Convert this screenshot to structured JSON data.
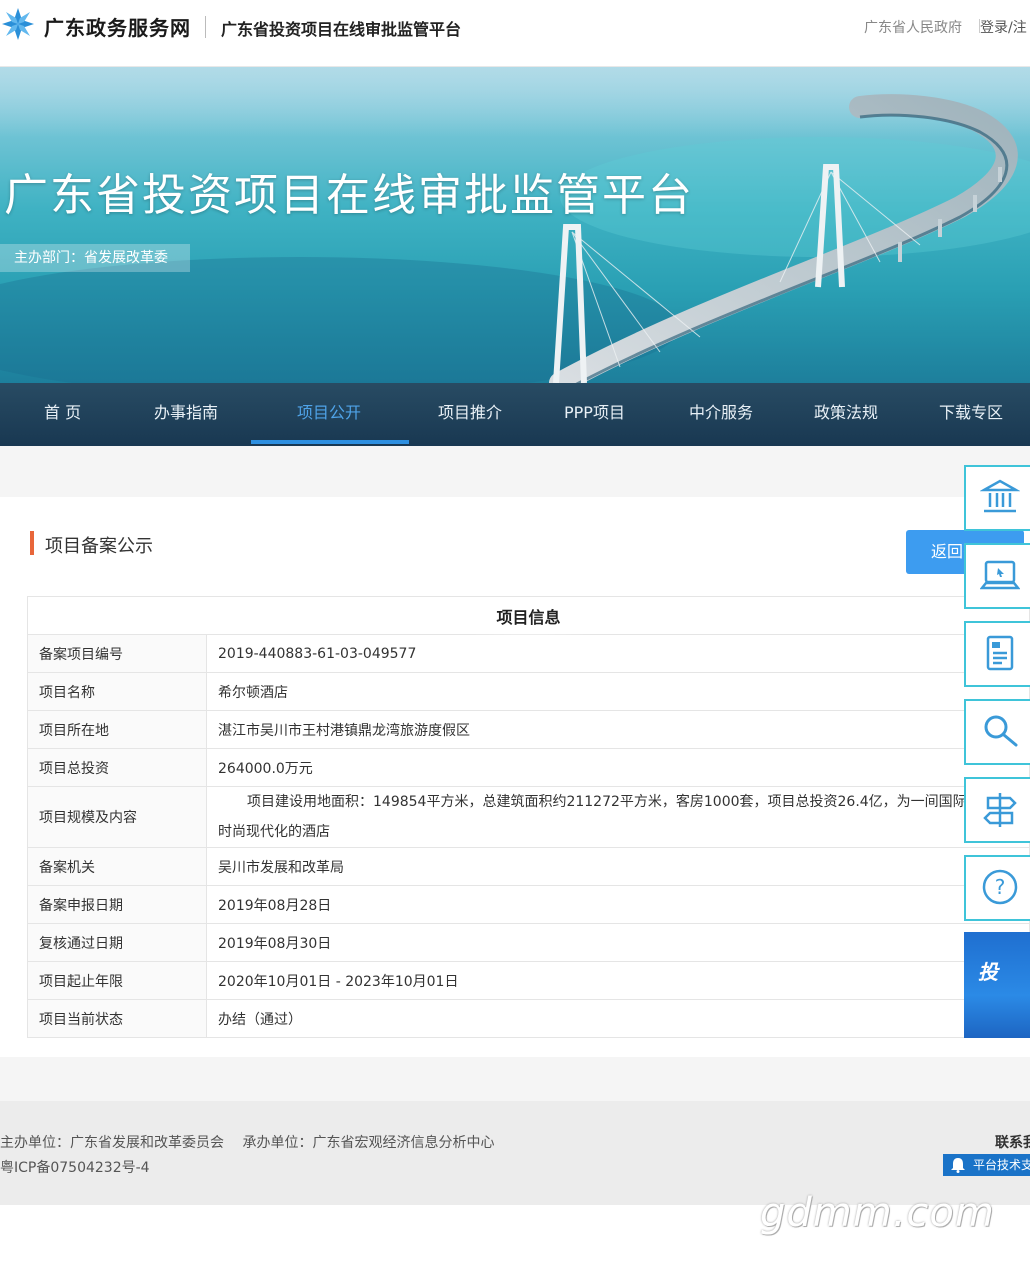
{
  "header": {
    "site_name": "广东政务服务网",
    "platform_name": "广东省投资项目在线审批监管平台",
    "gov_link": "广东省人民政府",
    "login_label": "登录/注"
  },
  "banner": {
    "title": "广东省投资项目在线审批监管平台",
    "department": "主办部门：省发展改革委"
  },
  "nav": {
    "items": [
      "首 页",
      "办事指南",
      "项目公开",
      "项目推介",
      "PPP项目",
      "中介服务",
      "政策法规",
      "下载专区"
    ],
    "active_index": 2,
    "active_color": "#4fa3e8"
  },
  "section": {
    "title": "项目备案公示",
    "back_button": "返回列表"
  },
  "table": {
    "header": "项目信息",
    "rows": [
      {
        "label": "备案项目编号",
        "value": "2019-440883-61-03-049577"
      },
      {
        "label": "项目名称",
        "value": "希尔顿酒店"
      },
      {
        "label": "项目所在地",
        "value": "湛江市吴川市王村港镇鼎龙湾旅游度假区"
      },
      {
        "label": "项目总投资",
        "value": "264000.0万元"
      },
      {
        "label": "项目规模及内容",
        "value": "项目建设用地面积：149854平方米，总建筑面积约211272平方米，客房1000套，项目总投资26.4亿，为一间国际品牌时尚现代化的酒店"
      },
      {
        "label": "备案机关",
        "value": "吴川市发展和改革局"
      },
      {
        "label": "备案申报日期",
        "value": "2019年08月28日"
      },
      {
        "label": "复核通过日期",
        "value": "2019年08月30日"
      },
      {
        "label": "项目起止年限",
        "value": "2020年10月01日 - 2023年10月01日"
      },
      {
        "label": "项目当前状态",
        "value": "办结（通过）"
      }
    ]
  },
  "float_tools": {
    "icons": [
      "government-building-icon",
      "computer-icon",
      "document-icon",
      "search-icon",
      "signpost-icon",
      "help-icon"
    ],
    "promo_big": "投"
  },
  "footer": {
    "host": "主办单位：广东省发展和改革委员会　 承办单位：广东省宏观经济信息分析中心",
    "icp": "粤ICP备07504232号-4",
    "contact": "联系我",
    "support": "平台技术支"
  },
  "watermark": "gdmm.com",
  "colors": {
    "nav_bg": "#163c56",
    "accent": "#3d9cf0",
    "section_marker": "#e8663a",
    "tool_border": "#3fc4d9"
  }
}
